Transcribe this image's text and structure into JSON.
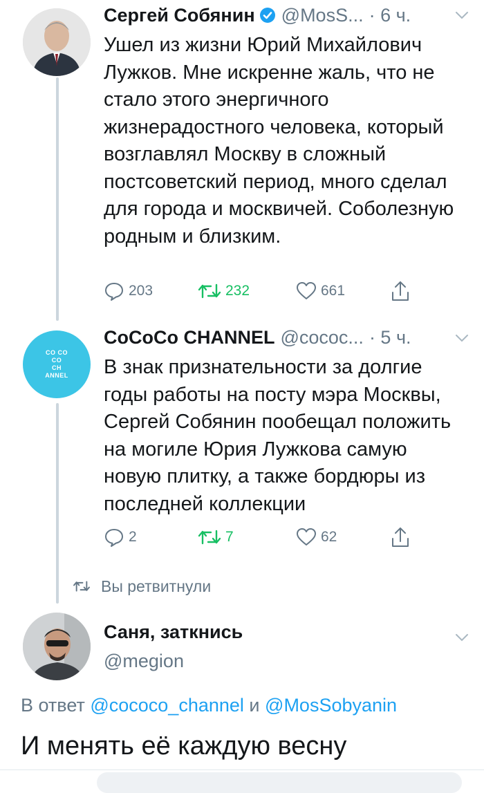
{
  "tweets": [
    {
      "name": "Сергей Собянин",
      "handle": "@MosS...",
      "time": "· 6 ч.",
      "verified": true,
      "text": "Ушел из жизни Юрий Михайлович Лужков. Мне искренне жаль, что не стало этого энергичного жизнерадостного человека, который возглавлял Москву в сложный постсоветский период, много сделал для города и москвичей. Соболезную родным и близким.",
      "replies": "203",
      "retweets": "232",
      "likes": "661"
    },
    {
      "name": "CoCoCo CHANNEL",
      "handle": "@cococ...",
      "time": "· 5 ч.",
      "verified": false,
      "avatar_text": [
        "CO CO",
        "CO",
        "CH",
        "ANNEL"
      ],
      "text": "В знак признательности за долгие годы работы на посту мэра Москвы, Сергей Собянин пообещал положить на могиле Юрия Лужкова самую новую плитку, а также бордюры из последней коллекции",
      "replies": "2",
      "retweets": "7",
      "likes": "62"
    }
  ],
  "retweeted_label": "Вы ретвитнули",
  "reply": {
    "name": "Саня, заткнись",
    "handle": "@megion",
    "reply_prefix": "В ответ",
    "mention_1": "@cococo_channel",
    "conjunction": "и",
    "mention_2": "@MosSobyanin",
    "text": "И менять её каждую весну"
  },
  "colors": {
    "accent": "#1da1f2",
    "retweet_green": "#17bf63",
    "secondary_text": "#657786",
    "thread_line": "#ccd6dd",
    "channel_avatar": "#3cc5e6"
  },
  "icons": {
    "verified": "verified-badge-icon",
    "chevron": "chevron-down-icon",
    "reply": "reply-icon",
    "retweet": "retweet-icon",
    "like": "heart-icon",
    "share": "share-icon"
  }
}
